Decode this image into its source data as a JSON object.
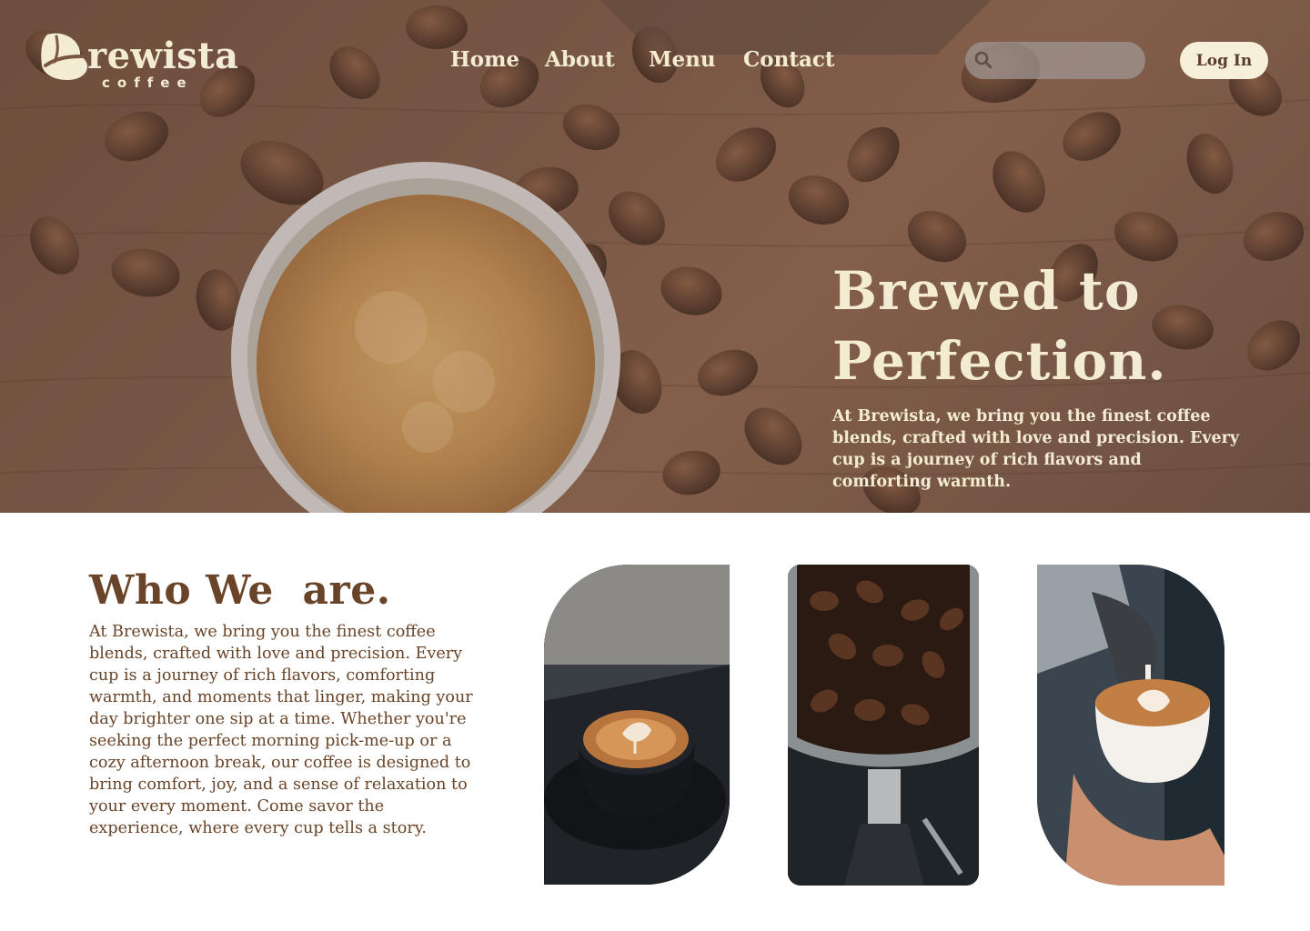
{
  "brand": {
    "name": "rewista",
    "subtitle": "coffee",
    "logo_icon": "coffee-bean-B-icon",
    "cream": "#f3ecd2",
    "brown": "#6a4428"
  },
  "nav": {
    "items": [
      {
        "label": "Home"
      },
      {
        "label": "About"
      },
      {
        "label": "Menu"
      },
      {
        "label": "Contact"
      }
    ]
  },
  "search": {
    "placeholder": "",
    "icon": "search-icon"
  },
  "login": {
    "label": "Log In"
  },
  "hero": {
    "title_line1": "Brewed to",
    "title_line2": "Perfection.",
    "text": "At Brewista, we bring you the finest coffee blends, crafted with love and precision. Every cup is a journey of rich flavors and comforting warmth."
  },
  "about": {
    "title": "Who We  are.",
    "text": "At Brewista, we bring you the finest coffee blends, crafted with love and precision. Every cup is a journey of rich flavors, comforting warmth, and moments that linger, making your day brighter one sip at a time. Whether you're seeking the perfect morning pick-me-up or a cozy afternoon break, our coffee is designed to bring comfort, joy, and a sense of relaxation to your every moment. Come savor the experience, where every cup tells a story."
  },
  "gallery": [
    {
      "subject": "latte-art-cup-photo"
    },
    {
      "subject": "coffee-beans-portafilter-photo"
    },
    {
      "subject": "pouring-latte-art-photo"
    }
  ]
}
